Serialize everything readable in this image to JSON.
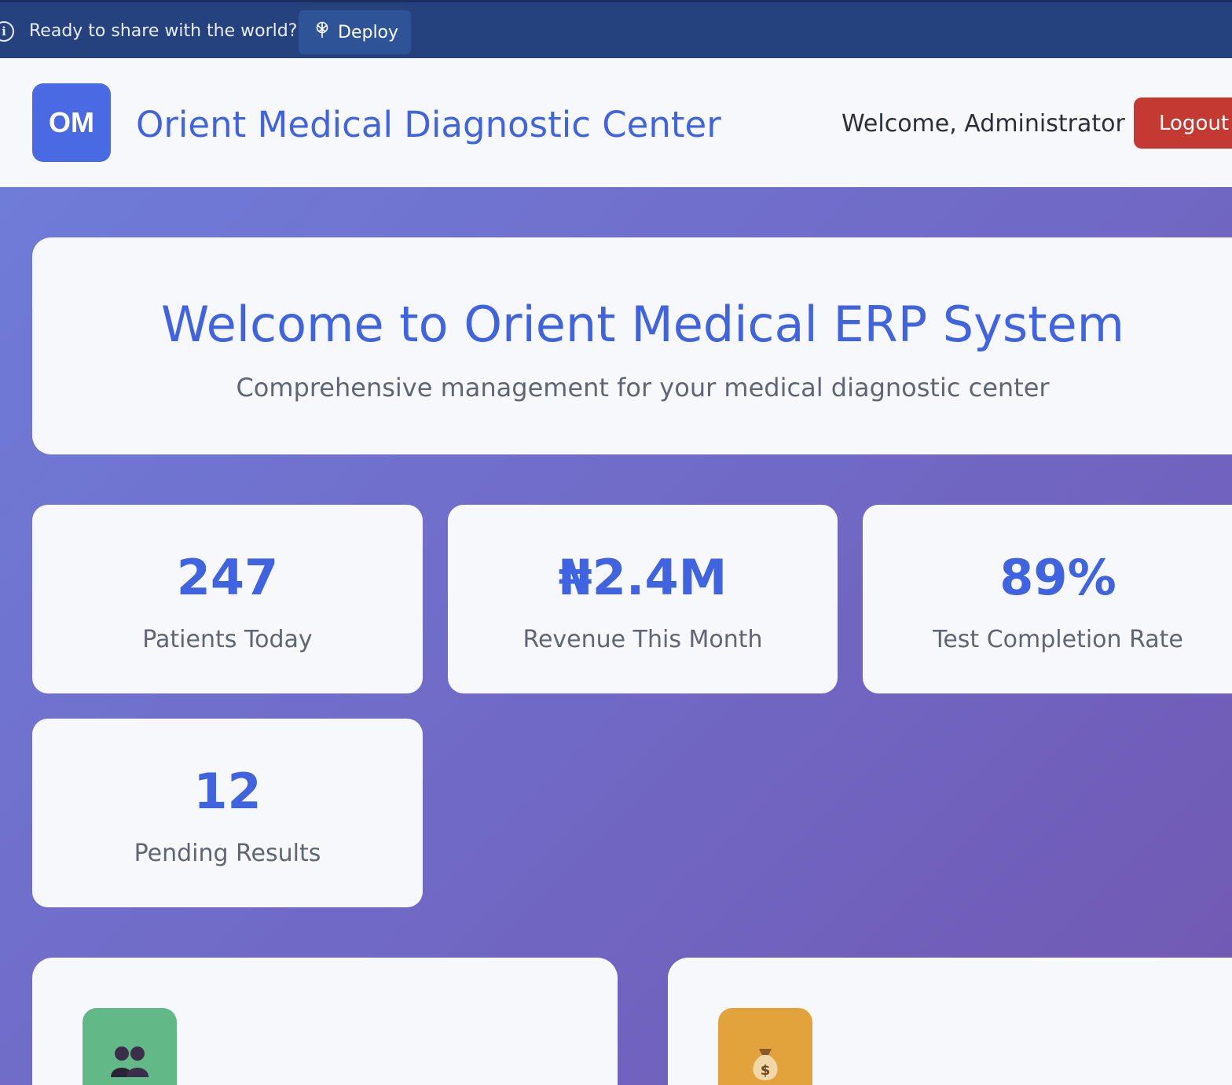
{
  "deploy_bar": {
    "message": "Ready to share with the world?",
    "deploy_label": "Deploy"
  },
  "header": {
    "logo_text": "OM",
    "title": "Orient Medical Diagnostic Center",
    "welcome": "Welcome, Administrator",
    "logout_label": "Logout"
  },
  "hero": {
    "title": "Welcome to Orient Medical ERP System",
    "subtitle": "Comprehensive management for your medical diagnostic center"
  },
  "stats": [
    {
      "value": "247",
      "label": "Patients Today"
    },
    {
      "value": "₦2.4M",
      "label": "Revenue This Month"
    },
    {
      "value": "89%",
      "label": "Test Completion Rate"
    },
    {
      "value": "12",
      "label": "Pending Results"
    }
  ],
  "modules": [
    {
      "icon": "users-icon",
      "color": "#62b886"
    },
    {
      "icon": "money-bag-icon",
      "color": "#e2a33c"
    }
  ],
  "colors": {
    "accent": "#4064e0",
    "logout": "#c43a32",
    "deploy_bar": "#25427f"
  }
}
